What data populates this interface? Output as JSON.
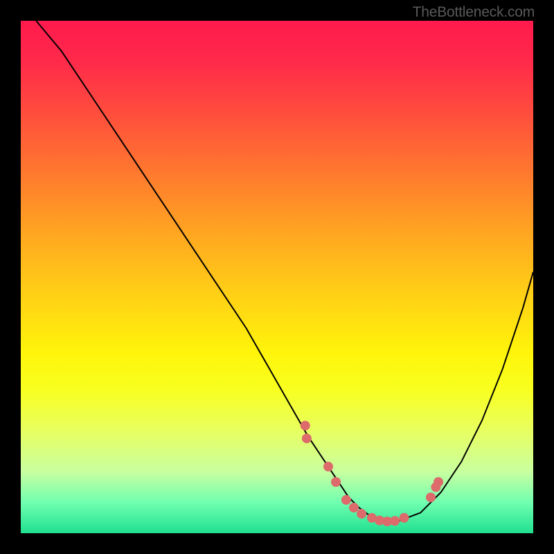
{
  "watermark": "TheBottleneck.com",
  "chart_data": {
    "type": "line",
    "title": "",
    "xlabel": "",
    "ylabel": "",
    "xlim": [
      0,
      100
    ],
    "ylim": [
      0,
      100
    ],
    "curve": {
      "x": [
        3,
        8,
        14,
        20,
        26,
        32,
        38,
        44,
        48,
        52,
        56,
        60,
        62,
        64,
        66,
        68,
        70,
        72,
        74,
        78,
        82,
        86,
        90,
        94,
        98,
        100
      ],
      "y": [
        100,
        94,
        85,
        76,
        67,
        58,
        49,
        40,
        33,
        26,
        19,
        13,
        10,
        7,
        5,
        3.5,
        2.5,
        2,
        2.5,
        4,
        8,
        14,
        22,
        32,
        44,
        51
      ]
    },
    "dots": {
      "x": [
        55.5,
        55.8,
        60.0,
        61.5,
        63.5,
        65.0,
        66.5,
        68.5,
        70.0,
        71.5,
        73.0,
        74.8,
        80.0,
        81.0,
        81.5
      ],
      "y": [
        21.0,
        18.5,
        13.0,
        10.0,
        6.5,
        5.0,
        3.8,
        3.0,
        2.5,
        2.3,
        2.4,
        3.0,
        7.0,
        9.0,
        10.0
      ]
    },
    "gradient_stops": [
      {
        "pct": 0,
        "color": "#ff1a4d"
      },
      {
        "pct": 18,
        "color": "#ff4d3d"
      },
      {
        "pct": 42,
        "color": "#ffa820"
      },
      {
        "pct": 65,
        "color": "#fff50a"
      },
      {
        "pct": 88,
        "color": "#c8ffa0"
      },
      {
        "pct": 100,
        "color": "#20e090"
      }
    ]
  }
}
